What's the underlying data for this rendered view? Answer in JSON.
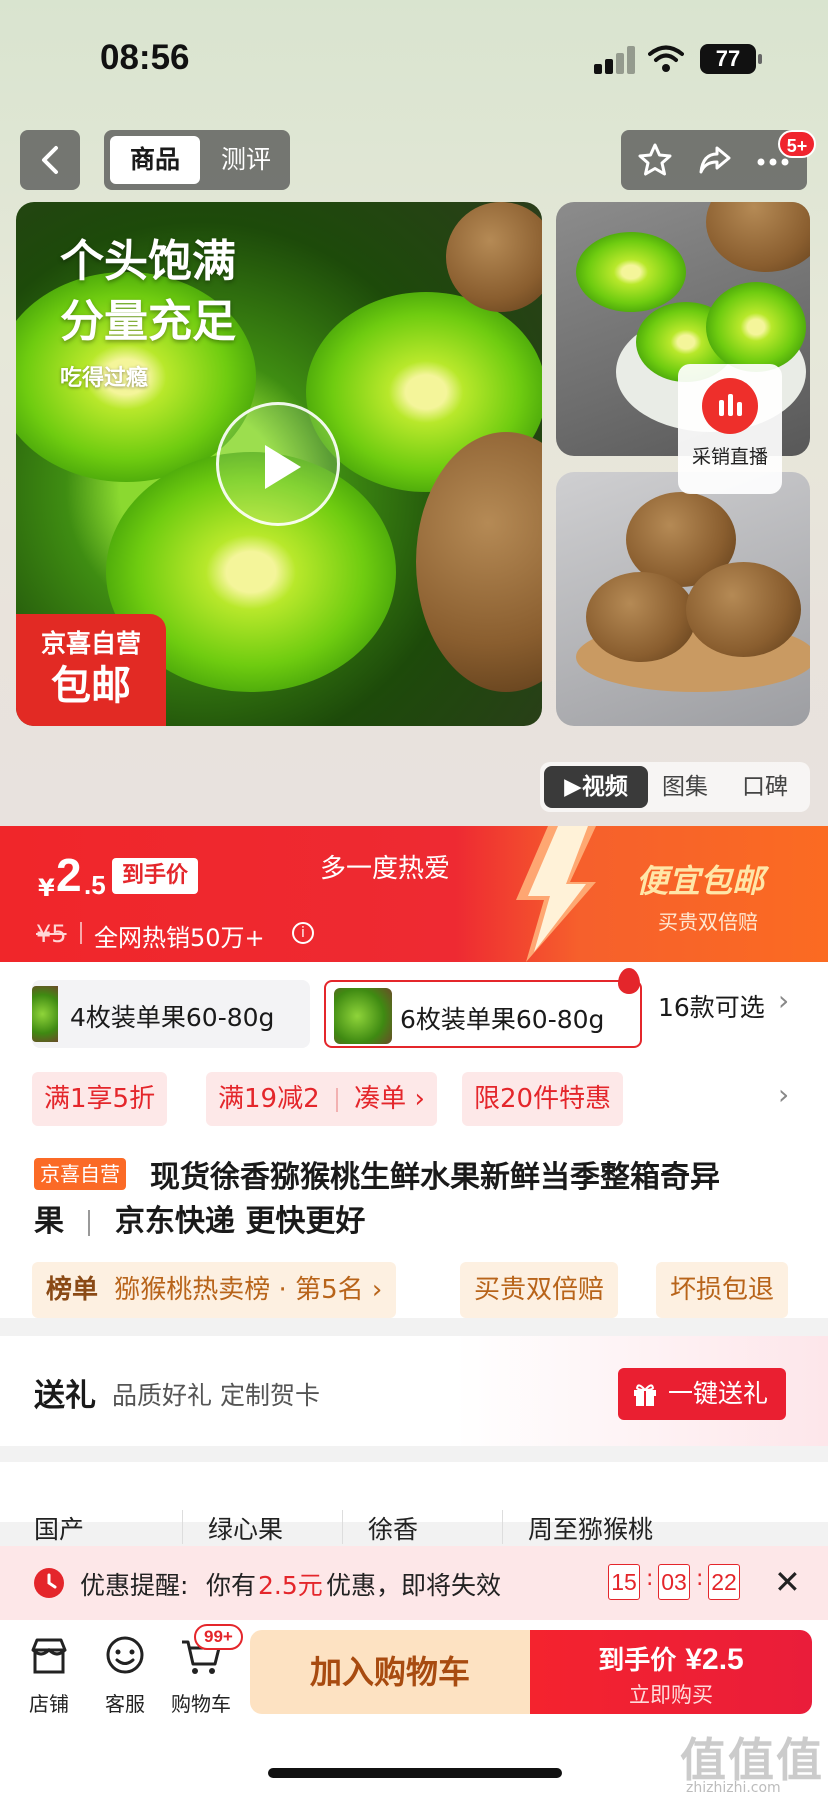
{
  "status_bar": {
    "time": "08:56",
    "battery": "77"
  },
  "nav": {
    "tab_product": "商品",
    "tab_review": "测评",
    "more_badge": "5+"
  },
  "gallery": {
    "headline_line1": "个头饱满",
    "headline_line2": "分量充足",
    "subline": "吃得过瘾",
    "tag_line1": "京喜自营",
    "tag_line2": "包邮",
    "live_label": "采销直播",
    "media_tabs": [
      "视频",
      "图集",
      "口碑"
    ]
  },
  "price": {
    "currency": "¥",
    "integer": "2",
    "decimal": ".5",
    "final_label": "到手价",
    "original": "¥5",
    "sales": "全网热销50万+",
    "slogan": "多一度热爱",
    "promo_title": "便宜包邮",
    "promo_sub": "买贵双倍赔"
  },
  "variants": {
    "items": [
      "4枚装单果60-80g",
      "6枚装单果60-80g"
    ],
    "more": "16款可选"
  },
  "promos": [
    "满1享5折",
    "满19减2",
    "凑单",
    "限20件特惠"
  ],
  "title": {
    "tag": "京喜自营",
    "line1": "现货徐香猕猴桃生鲜水果新鲜当季整箱奇异",
    "line2_a": "果",
    "line2_b": "京东快递 更快更好"
  },
  "tags": {
    "rank_label": "榜单",
    "rank_text": "猕猴桃热卖榜 · 第5名",
    "t2": "买贵双倍赔",
    "t3": "坏损包退"
  },
  "gift": {
    "title": "送礼",
    "desc": "品质好礼 定制贺卡",
    "button": "一键送礼"
  },
  "specs": [
    "国产",
    "绿心果",
    "徐香",
    "周至猕猴桃"
  ],
  "reminder": {
    "label": "优惠提醒:",
    "text_before": "你有",
    "amount": "2.5元",
    "text_after": "优惠，即将失效",
    "hh": "15",
    "mm": "03",
    "ss": "22"
  },
  "bottom": {
    "shop": "店铺",
    "service": "客服",
    "cart": "购物车",
    "cart_badge": "99+",
    "add_cart": "加入购物车",
    "buy_label": "到手价",
    "buy_price": "¥2.5",
    "buy_now": "立即购买"
  },
  "watermark": {
    "main": "值值值",
    "sub": "zhizhizhi.com"
  }
}
